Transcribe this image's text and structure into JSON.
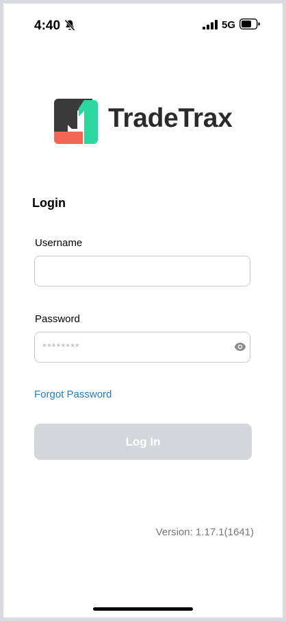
{
  "status_bar": {
    "time": "4:40",
    "network": "5G"
  },
  "brand": {
    "name": "TradeTrax",
    "colors": {
      "dark": "#3a3a3a",
      "green": "#2bd6a0",
      "red": "#f36656"
    }
  },
  "login": {
    "heading": "Login",
    "username_label": "Username",
    "username_value": "",
    "password_label": "Password",
    "password_placeholder": "********",
    "forgot_password": "Forgot Password",
    "submit_label": "Log In"
  },
  "footer": {
    "version": "Version: 1.17.1(1641)"
  },
  "icons": {
    "silent_mode": "bell-slash-icon",
    "signal": "cellular-signal-icon",
    "battery": "battery-icon",
    "show_password": "eye-icon"
  },
  "accent_colors": {
    "link": "#1f7dc4",
    "button_disabled": "#d5d5dc"
  }
}
